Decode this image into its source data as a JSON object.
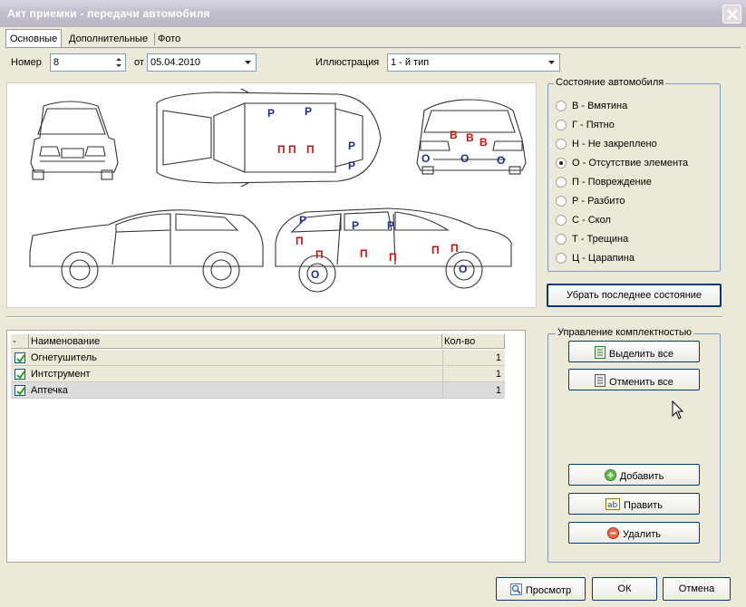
{
  "window": {
    "title": "Акт приемки - передачи автомобиля"
  },
  "tabs": [
    {
      "label": "Основные",
      "active": true
    },
    {
      "label": "Дополнительные",
      "active": false
    },
    {
      "label": "Фото",
      "active": false
    }
  ],
  "form": {
    "number_label": "Номер",
    "number_value": "8",
    "date_label": "от",
    "date_value": "05.04.2010",
    "illustration_label": "Иллюстрация",
    "illustration_value": "1 - й тип"
  },
  "diagram_marks": [
    {
      "t": "Р",
      "c": "blue"
    },
    {
      "t": "Р",
      "c": "blue"
    },
    {
      "t": "П П",
      "c": "red"
    },
    {
      "t": "П",
      "c": "red"
    },
    {
      "t": "Р",
      "c": "blue"
    },
    {
      "t": "Р",
      "c": "blue"
    },
    {
      "t": "В",
      "c": "red"
    },
    {
      "t": "В",
      "c": "red"
    },
    {
      "t": "В",
      "c": "red"
    },
    {
      "t": "О",
      "c": "blue"
    },
    {
      "t": "О",
      "c": "blue"
    },
    {
      "t": "О",
      "c": "blue"
    },
    {
      "t": "Р",
      "c": "blue"
    },
    {
      "t": "Р",
      "c": "blue"
    },
    {
      "t": "Р",
      "c": "blue"
    },
    {
      "t": "П",
      "c": "red"
    },
    {
      "t": "П",
      "c": "red"
    },
    {
      "t": "П",
      "c": "red"
    },
    {
      "t": "П",
      "c": "red"
    },
    {
      "t": "П",
      "c": "red"
    },
    {
      "t": "П",
      "c": "red"
    },
    {
      "t": "О",
      "c": "blue"
    },
    {
      "t": "О",
      "c": "blue"
    }
  ],
  "state_group": {
    "title": "Состояние автомобиля",
    "options": [
      {
        "label": "В - Вмятина",
        "checked": false
      },
      {
        "label": "Г - Пятно",
        "checked": false
      },
      {
        "label": "Н - Не закреплено",
        "checked": false
      },
      {
        "label": "О - Отсутствие элемента",
        "checked": true
      },
      {
        "label": "П - Повреждение",
        "checked": false
      },
      {
        "label": "Р - Разбито",
        "checked": false
      },
      {
        "label": "С - Скол",
        "checked": false
      },
      {
        "label": "Т - Трещина",
        "checked": false
      },
      {
        "label": "Ц - Царапина",
        "checked": false
      }
    ],
    "remove_last_label": "Убрать последнее состояние"
  },
  "grid": {
    "headers": {
      "check": "-",
      "name": "Наименование",
      "qty": "Кол-во"
    },
    "rows": [
      {
        "checked": true,
        "name": "Огнетушитель",
        "qty": "1"
      },
      {
        "checked": true,
        "name": "Интструмент",
        "qty": "1"
      },
      {
        "checked": true,
        "name": "Аптечка",
        "qty": "1"
      }
    ]
  },
  "kit_group": {
    "title": "Управление комплектностью",
    "select_all": "Выделить все",
    "deselect_all": "Отменить все",
    "add": "Добавить",
    "edit": "Править",
    "delete": "Удалить"
  },
  "footer": {
    "preview": "Просмотр",
    "ok": "ОК",
    "cancel": "Отмена"
  },
  "colors": {
    "mark_red": "#cc1111",
    "mark_blue": "#1f2f8e",
    "button_border": "#003c74",
    "field_border": "#7f9db9"
  }
}
